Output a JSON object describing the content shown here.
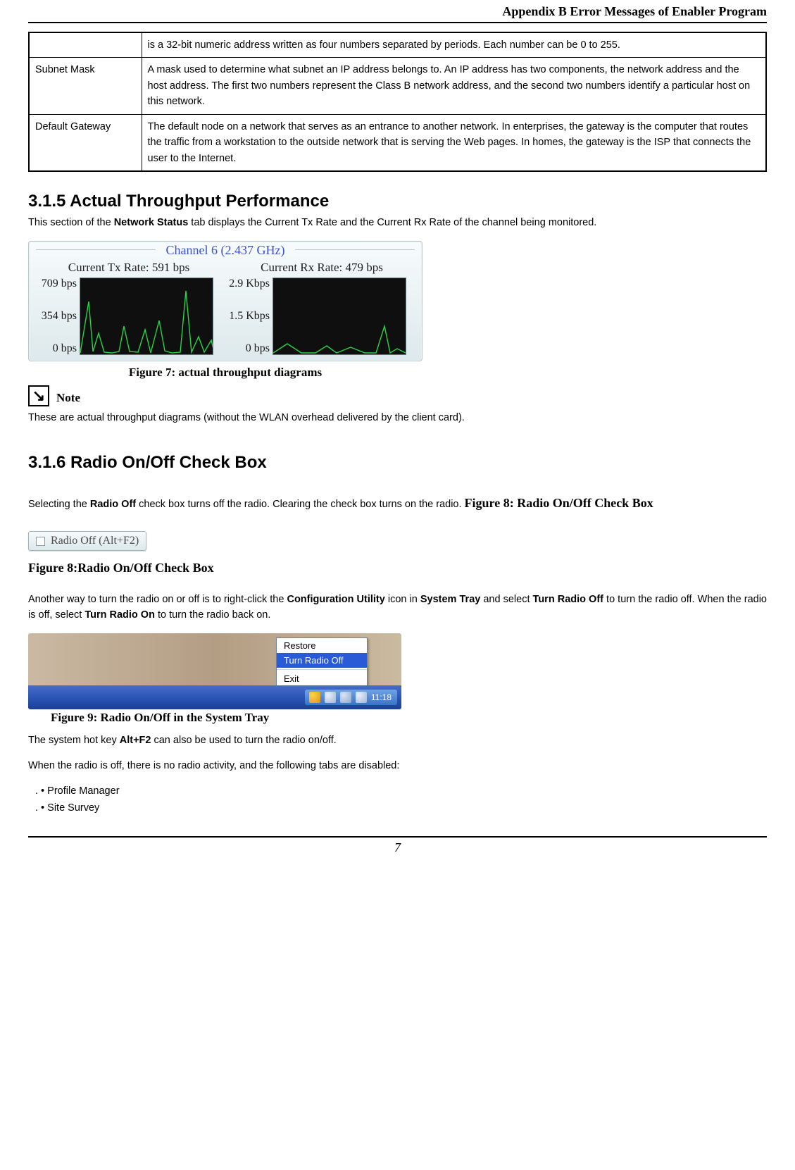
{
  "header": {
    "appendix_title": "Appendix B Error Messages of Enabler Program"
  },
  "table": {
    "rows": [
      {
        "term": "",
        "desc": "is a 32-bit numeric address written as four numbers separated by periods. Each number can be 0 to 255."
      },
      {
        "term": "Subnet Mask",
        "desc": "A mask used to determine what subnet an IP address belongs to. An IP address has two components, the network address and the host address. The first two numbers represent the Class B network address, and the second two numbers identify a particular host on this network."
      },
      {
        "term": "Default Gateway",
        "desc": "The default node on a network that serves as an entrance to another network. In enterprises, the gateway is the computer that routes the traffic from a workstation to the outside network that is serving the Web pages. In homes, the gateway is the ISP that connects the user to the Internet."
      }
    ]
  },
  "sec315": {
    "heading": "3.1.5 Actual Throughput Performance",
    "intro_a": "This section of the ",
    "intro_b": "Network Status",
    "intro_c": " tab displays the Current Tx Rate and the Current Rx Rate of the channel being monitored."
  },
  "throughput": {
    "channel_label": "Channel 6 (2.437 GHz)",
    "tx_label": "Current Tx Rate: 591 bps",
    "rx_label": "Current Rx Rate: 479 bps",
    "tx_y": [
      "709 bps",
      "354 bps",
      "0 bps"
    ],
    "rx_y": [
      "2.9 Kbps",
      "1.5 Kbps",
      "0 bps"
    ],
    "fig7_caption": "Figure 7: actual throughput diagrams"
  },
  "note": {
    "label": "Note",
    "text": "These are actual throughput diagrams (without the WLAN overhead delivered by the client card)."
  },
  "sec316": {
    "heading": "3.1.6 Radio On/Off Check Box",
    "p1_a": "Selecting the ",
    "p1_b": "Radio Off",
    "p1_c": " check box turns off the radio. Clearing the check box turns on the radio. ",
    "p1_d": "Figure 8: Radio On/Off Check Box",
    "button_text": "Radio Off  (Alt+F2)",
    "fig8_caption": "Figure 8:Radio On/Off Check Box",
    "p2_a": "Another way to turn the radio on or off is to right-click the ",
    "p2_b": "Configuration Utility",
    "p2_c": " icon in ",
    "p2_d": "System Tray",
    "p2_e": " and select ",
    "p2_f": "Turn Radio Off",
    "p2_g": " to turn the radio off. When the radio is off, select ",
    "p2_h": "Turn Radio On",
    "p2_i": " to turn the radio back on.",
    "menu": {
      "restore": "Restore",
      "turn_off": "Turn Radio Off",
      "exit": "Exit"
    },
    "clock": "11:18",
    "fig9_caption": "Figure 9: Radio On/Off in the System Tray",
    "hotkey_a": "The system hot key ",
    "hotkey_b": "Alt+F2",
    "hotkey_c": " can also be used to turn the radio on/off.",
    "disabled_intro": "When the radio is off, there is no radio activity, and the following tabs are disabled:",
    "li1": ".        • Profile Manager",
    "li2": ".        • Site Survey"
  },
  "page_number": "7",
  "chart_data": [
    {
      "type": "line",
      "title": "Current Tx Rate",
      "ylabel": "bps",
      "ylim": [
        0,
        709
      ],
      "current_value_bps": 591,
      "y_ticks": [
        "709 bps",
        "354 bps",
        "0 bps"
      ]
    },
    {
      "type": "line",
      "title": "Current Rx Rate",
      "ylabel": "bps",
      "ylim": [
        0,
        2900
      ],
      "current_value_bps": 479,
      "y_ticks": [
        "2.9 Kbps",
        "1.5 Kbps",
        "0 bps"
      ]
    }
  ]
}
